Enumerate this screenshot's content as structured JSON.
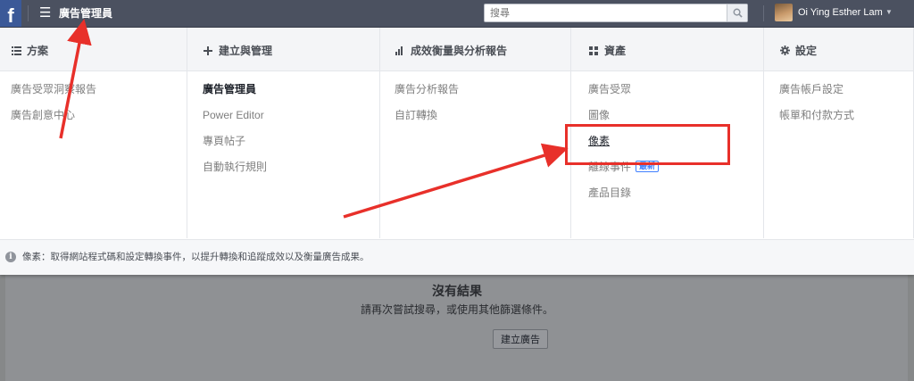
{
  "topbar": {
    "logo": "f",
    "menu_icon": "☰",
    "app_title": "廣告管理員",
    "search_placeholder": "搜尋",
    "search_icon": "magnifier-icon",
    "user_name": "Oi Ying Esther Lam",
    "user_caret": "▼"
  },
  "menu": {
    "columns": [
      {
        "icon": "list-icon",
        "title": "方案",
        "items": [
          "廣告受眾洞察報告",
          "廣告創意中心"
        ]
      },
      {
        "icon": "plus-icon",
        "title": "建立與管理",
        "items": [
          "廣告管理員",
          "Power Editor",
          "專頁帖子",
          "自動執行規則"
        ]
      },
      {
        "icon": "bar-chart-icon",
        "title": "成效衡量與分析報告",
        "items": [
          "廣告分析報告",
          "自訂轉換"
        ]
      },
      {
        "icon": "grid-icon",
        "title": "資產",
        "items": [
          "廣告受眾",
          "圖像",
          "像素",
          "離線事件",
          "產品目錄"
        ],
        "badge": "最新"
      },
      {
        "icon": "gear-icon",
        "title": "設定",
        "items": [
          "廣告帳戶設定",
          "帳單和付款方式"
        ]
      }
    ],
    "hint_icon": "i",
    "hint_text": "像素：取得網站程式碼和設定轉換事件，以提升轉換和追蹤成效以及衡量廣告成果。"
  },
  "background": {
    "empty_title": "沒有結果",
    "empty_subtitle": "請再次嘗試搜尋，或使用其他篩選條件。",
    "create_ad_label": "建立廣告"
  },
  "colors": {
    "topbar": "#4b5160",
    "fb_blue": "#3b5998",
    "annotation_red": "#e8302a",
    "badge_blue": "#4080ff"
  }
}
